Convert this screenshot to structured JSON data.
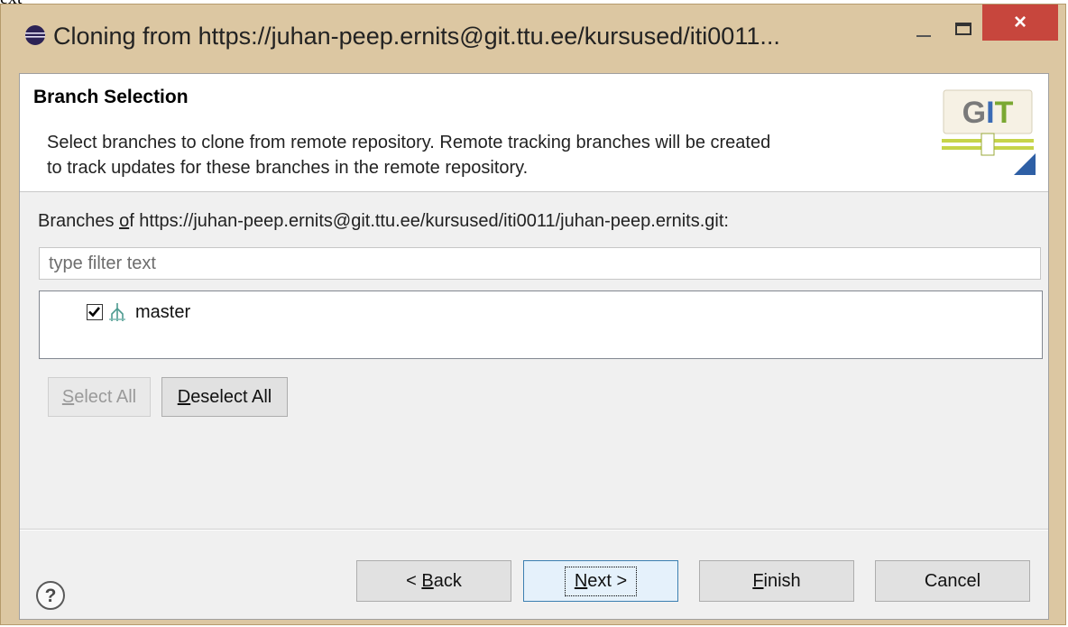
{
  "stray_text": "ext",
  "window": {
    "title": "Cloning from https://juhan-peep.ernits@git.ttu.ee/kursused/iti0011...",
    "close_label": "×"
  },
  "header": {
    "title": "Branch Selection",
    "description_line1": "Select branches to clone from remote repository. Remote tracking branches will be created",
    "description_line2": "to track updates for these branches in the remote repository.",
    "logo_text": "GIT"
  },
  "branches": {
    "label_prefix": "Branches ",
    "label_mnemonic": "o",
    "label_middle": "f",
    "label_suffix": " https://juhan-peep.ernits@git.ttu.ee/kursused/iti0011/juhan-peep.ernits.git:",
    "filter_placeholder": "type filter text",
    "items": [
      {
        "name": "master",
        "checked": true
      }
    ]
  },
  "selection_buttons": {
    "select_all_mnemonic": "S",
    "select_all_rest": "elect All",
    "deselect_all_mnemonic": "D",
    "deselect_all_rest": "eselect All"
  },
  "footer": {
    "back_prefix": "< ",
    "back_mnemonic": "B",
    "back_rest": "ack",
    "next_mnemonic": "N",
    "next_rest": "ext >",
    "finish_mnemonic": "F",
    "finish_rest": "inish",
    "cancel_label": "Cancel"
  },
  "colors": {
    "window_frame": "#dcc7a2",
    "close_button": "#c7463d",
    "dialog_background": "#f0f0f0",
    "focus_border": "#3c7fb1"
  }
}
